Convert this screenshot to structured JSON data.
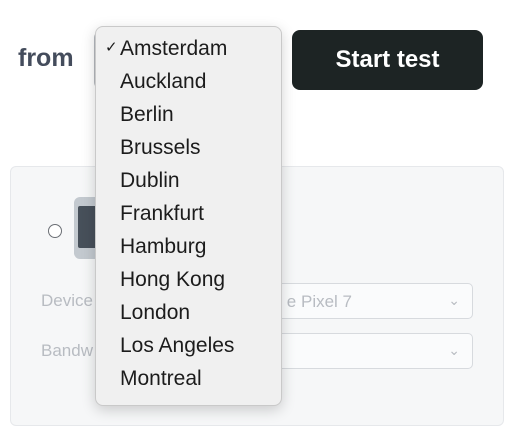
{
  "from_label": "from",
  "location_select": {
    "selected": "Amsterdam"
  },
  "start_button_label": "Start test",
  "device_panel": {
    "device_label": "Device",
    "device_value": "e Pixel 7",
    "bandwidth_label": "Bandw",
    "chevron_icon": "chevron-down-icon",
    "phone_icon": "phone-icon"
  },
  "dropdown": {
    "checkmark": "✓",
    "options": [
      "Amsterdam",
      "Auckland",
      "Berlin",
      "Brussels",
      "Dublin",
      "Frankfurt",
      "Hamburg",
      "Hong Kong",
      "London",
      "Los Angeles",
      "Montreal"
    ]
  },
  "colors": {
    "button_bg": "#1d2424",
    "dropdown_bg": "#f0f0f0",
    "label_text": "#444c5c"
  }
}
